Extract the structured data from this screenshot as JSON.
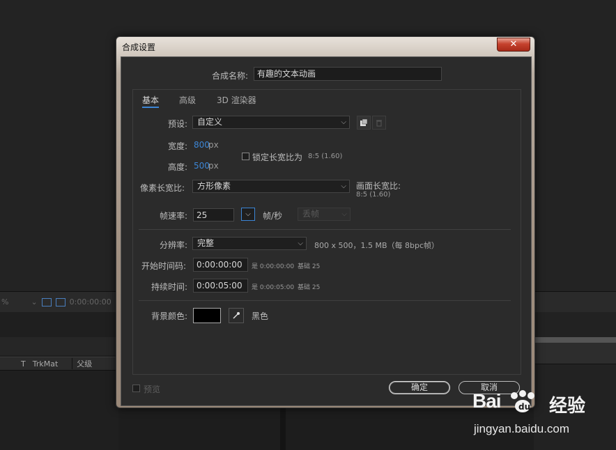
{
  "background": {
    "timecode": "0:00:00:00",
    "zoom_suffix": "%",
    "columns": [
      "T",
      "TrkMat",
      "父级"
    ]
  },
  "dialog": {
    "title": "合成设置",
    "close_glyph": "✕",
    "name_label": "合成名称:",
    "name_value": "有趣的文本动画",
    "tabs": [
      "基本",
      "高级",
      "3D 渲染器"
    ],
    "preset": {
      "label": "预设:",
      "value": "自定义"
    },
    "width": {
      "label": "宽度:",
      "value": "800",
      "unit": "px"
    },
    "height": {
      "label": "高度:",
      "value": "500",
      "unit": "px"
    },
    "lock_aspect": {
      "label": "锁定长宽比为",
      "ratio": "8:5 (1.60)",
      "checked": false
    },
    "pixel_aspect": {
      "label": "像素长宽比:",
      "value": "方形像素"
    },
    "frame_aspect": {
      "label": "画面长宽比:",
      "value": "8:5 (1.60)"
    },
    "frame_rate": {
      "label": "帧速率:",
      "value": "25",
      "unit": "帧/秒",
      "drop_frame": "丢帧"
    },
    "resolution": {
      "label": "分辨率:",
      "value": "完整",
      "info": "800 x 500，1.5 MB（每 8bpc帧）"
    },
    "start_timecode": {
      "label": "开始时间码:",
      "value": "0:00:00:00",
      "note": "是 0:00:00:00",
      "base": "基础 25"
    },
    "duration": {
      "label": "持续时间:",
      "value": "0:00:05:00",
      "note": "是 0:00:05:00",
      "base": "基础 25"
    },
    "bg_color": {
      "label": "背景颜色:",
      "name": "黑色",
      "color": "#000000"
    },
    "preview": {
      "label": "预览",
      "checked": false
    },
    "ok_label": "确定",
    "cancel_label": "取消"
  },
  "watermark": {
    "brand_text": "Bai",
    "brand_cn": "经验",
    "url": "jingyan.baidu.com"
  },
  "colors": {
    "accent": "#3c86d6",
    "close_red": "#c5422e"
  }
}
